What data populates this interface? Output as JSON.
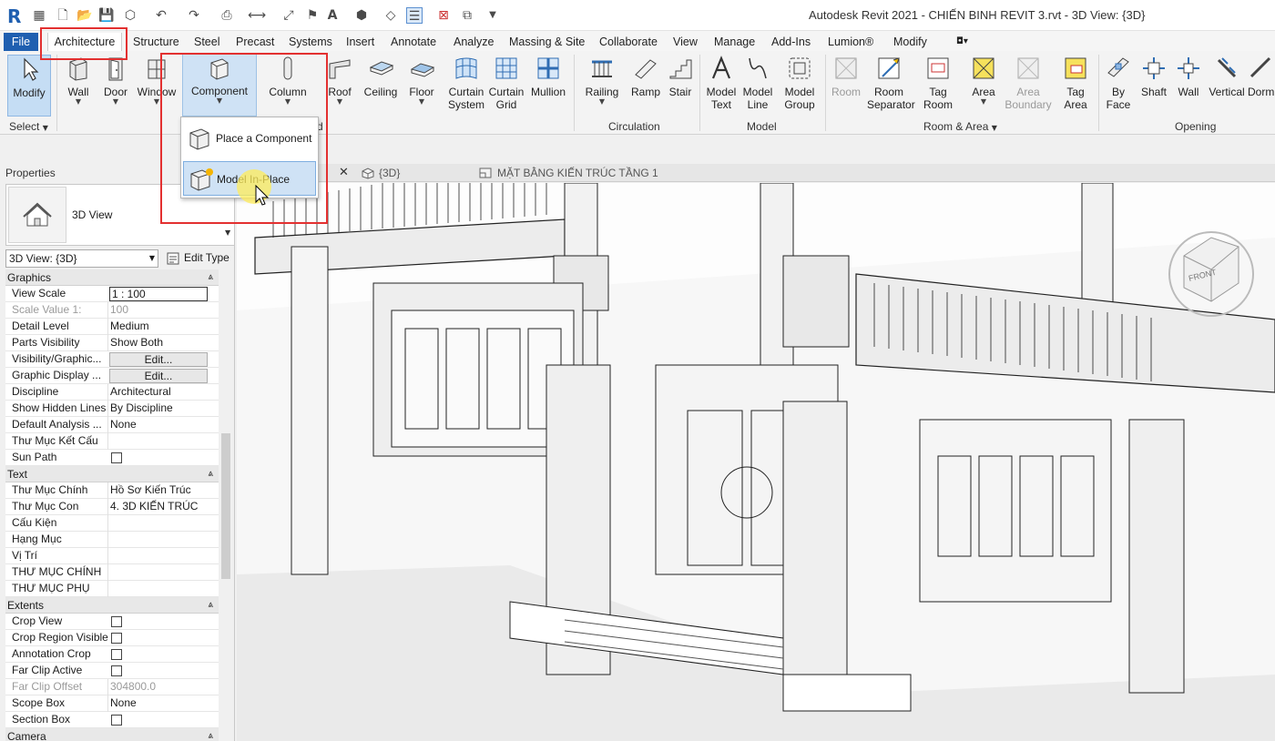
{
  "window": {
    "title": "Autodesk Revit 2021 - CHIẾN BINH REVIT 3.rvt - 3D View: {3D}",
    "app_letter": "R"
  },
  "tabs": [
    {
      "label": "File"
    },
    {
      "label": "Architecture"
    },
    {
      "label": "Structure"
    },
    {
      "label": "Steel"
    },
    {
      "label": "Precast"
    },
    {
      "label": "Systems"
    },
    {
      "label": "Insert"
    },
    {
      "label": "Annotate"
    },
    {
      "label": "Analyze"
    },
    {
      "label": "Massing & Site"
    },
    {
      "label": "Collaborate"
    },
    {
      "label": "View"
    },
    {
      "label": "Manage"
    },
    {
      "label": "Add-Ins"
    },
    {
      "label": "Lumion®"
    },
    {
      "label": "Modify"
    }
  ],
  "ribbon": {
    "modify": "Modify",
    "select": "Select",
    "wall": "Wall",
    "door": "Door",
    "window": "Window",
    "component": "Component",
    "column": "Column",
    "roof": "Roof",
    "ceiling": "Ceiling",
    "floor": "Floor",
    "curtain_system_1": "Curtain",
    "curtain_system_2": "System",
    "curtain_grid_1": "Curtain",
    "curtain_grid_2": "Grid",
    "mullion": "Mullion",
    "railing": "Railing",
    "ramp": "Ramp",
    "stair": "Stair",
    "model_text_1": "Model",
    "model_text_2": "Text",
    "model_line_1": "Model",
    "model_line_2": "Line",
    "model_group_1": "Model",
    "model_group_2": "Group",
    "room": "Room",
    "room_separator_1": "Room",
    "room_separator_2": "Separator",
    "tag_room_1": "Tag",
    "tag_room_2": "Room",
    "area": "Area",
    "area_boundary_1": "Area",
    "area_boundary_2": "Boundary",
    "tag_area_1": "Tag",
    "tag_area_2": "Area",
    "by_face_1": "By",
    "by_face_2": "Face",
    "shaft": "Shaft",
    "opening_wall": "Wall",
    "vertical": "Vertical",
    "dormer": "Dorm",
    "panels": {
      "circulation": "Circulation",
      "model": "Model",
      "room_area": "Room & Area",
      "opening": "Opening",
      "build_partial": "d"
    }
  },
  "dropdown": {
    "place_component": "Place a Component",
    "model_in_place": "Model In-Place"
  },
  "properties": {
    "title": "Properties",
    "type_name": "3D View",
    "view_selector": "3D View: {3D}",
    "edit_type": "Edit Type",
    "groups": {
      "graphics": "Graphics",
      "text": "Text",
      "extents": "Extents",
      "camera": "Camera"
    },
    "rows": {
      "view_scale": {
        "k": "View Scale",
        "v": "1 : 100"
      },
      "scale_value": {
        "k": "Scale Value    1:",
        "v": "100"
      },
      "detail_level": {
        "k": "Detail Level",
        "v": "Medium"
      },
      "parts_visibility": {
        "k": "Parts Visibility",
        "v": "Show Both"
      },
      "visibility_graphics": {
        "k": "Visibility/Graphic...",
        "v": "Edit..."
      },
      "graphic_display": {
        "k": "Graphic Display ...",
        "v": "Edit..."
      },
      "discipline": {
        "k": "Discipline",
        "v": "Architectural"
      },
      "show_hidden_lines": {
        "k": "Show Hidden Lines",
        "v": "By Discipline"
      },
      "default_analysis": {
        "k": "Default Analysis ...",
        "v": "None"
      },
      "thu_muc_ket_cau": {
        "k": "Thư Mục Kết Cấu",
        "v": ""
      },
      "sun_path": {
        "k": "Sun Path",
        "v": ""
      },
      "thu_muc_chinh": {
        "k": "Thư Mục Chính",
        "v": "Hồ Sơ Kiến Trúc"
      },
      "thu_muc_con": {
        "k": "Thư Mục Con",
        "v": "4. 3D KIẾN TRÚC"
      },
      "cau_kien": {
        "k": "Cấu Kiện",
        "v": ""
      },
      "hang_muc": {
        "k": "Hạng Mục",
        "v": ""
      },
      "vi_tri": {
        "k": "Vị Trí",
        "v": ""
      },
      "thu_muc_chinh_caps": {
        "k": "THƯ MỤC CHÍNH",
        "v": ""
      },
      "thu_muc_phu": {
        "k": "THƯ MỤC PHỤ",
        "v": ""
      },
      "crop_view": {
        "k": "Crop View",
        "v": ""
      },
      "crop_region_visible": {
        "k": "Crop Region Visible",
        "v": ""
      },
      "annotation_crop": {
        "k": "Annotation Crop",
        "v": ""
      },
      "far_clip_active": {
        "k": "Far Clip Active",
        "v": ""
      },
      "far_clip_offset": {
        "k": "Far Clip Offset",
        "v": "304800.0"
      },
      "scope_box": {
        "k": "Scope Box",
        "v": "None"
      },
      "section_box": {
        "k": "Section Box",
        "v": ""
      }
    }
  },
  "view_tabs": {
    "close": "✕",
    "tab_3d": "{3D}",
    "tab_plan": "MẶT BẰNG KIẾN TRÚC TẦNG 1"
  },
  "viewcube": {
    "front": "FRONT"
  },
  "colors": {
    "accent": "#1f5fb0",
    "highlight": "#e33030",
    "selection": "#cfe2f5"
  }
}
